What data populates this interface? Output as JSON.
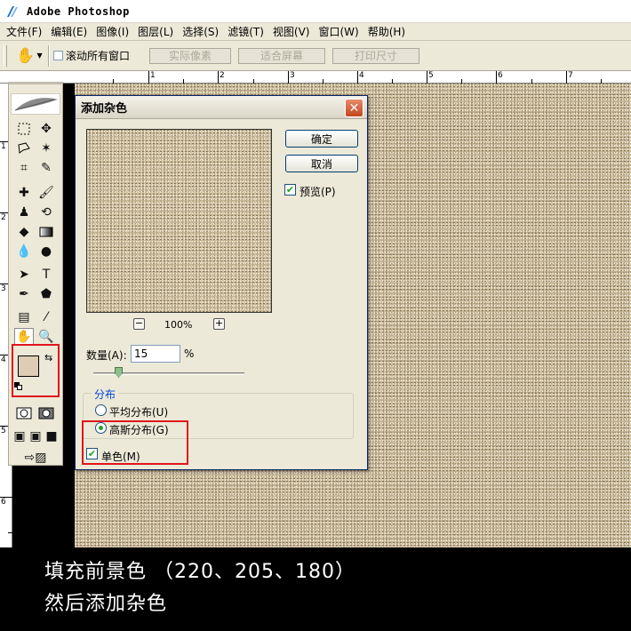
{
  "app": {
    "title": "Adobe Photoshop"
  },
  "menu": {
    "items": [
      "文件(F)",
      "编辑(E)",
      "图像(I)",
      "图层(L)",
      "选择(S)",
      "滤镜(T)",
      "视图(V)",
      "窗口(W)",
      "帮助(H)"
    ]
  },
  "options": {
    "scroll_all_label": "滚动所有窗口",
    "btn_actual": "实际像素",
    "btn_fit": "适合屏幕",
    "btn_print": "打印尺寸"
  },
  "ruler": {
    "h_marks": [
      "1",
      "2",
      "3",
      "4",
      "5",
      "6",
      "7"
    ],
    "v_marks": [
      "1",
      "2",
      "3",
      "4",
      "5",
      "6"
    ]
  },
  "colors": {
    "foreground": "#dccdb4",
    "background": "#ffffff",
    "highlight": "#e0161c"
  },
  "dialog": {
    "title": "添加杂色",
    "ok_label": "确定",
    "cancel_label": "取消",
    "preview_label": "预览(P)",
    "zoom_out": "−",
    "zoom_in": "+",
    "zoom": "100%",
    "amount_label": "数量(A):",
    "amount_value": "15",
    "amount_unit": "%",
    "distribution_title": "分布",
    "uniform_label": "平均分布(U)",
    "gaussian_label": "高斯分布(G)",
    "mono_label": "单色(M)",
    "close_glyph": "✕"
  },
  "caption": {
    "line1": "填充前景色 （220、205、180）",
    "line2": "然后添加杂色"
  }
}
